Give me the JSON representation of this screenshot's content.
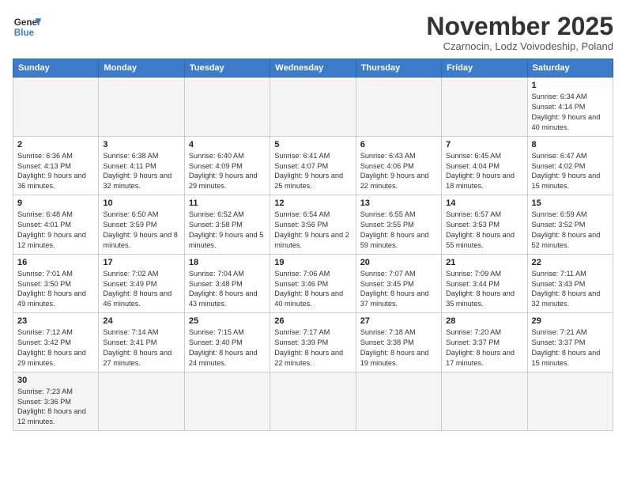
{
  "header": {
    "logo_general": "General",
    "logo_blue": "Blue",
    "month_title": "November 2025",
    "location": "Czarnocin, Lodz Voivodeship, Poland"
  },
  "weekdays": [
    "Sunday",
    "Monday",
    "Tuesday",
    "Wednesday",
    "Thursday",
    "Friday",
    "Saturday"
  ],
  "weeks": [
    [
      {
        "day": "",
        "info": "",
        "empty": true
      },
      {
        "day": "",
        "info": "",
        "empty": true
      },
      {
        "day": "",
        "info": "",
        "empty": true
      },
      {
        "day": "",
        "info": "",
        "empty": true
      },
      {
        "day": "",
        "info": "",
        "empty": true
      },
      {
        "day": "",
        "info": "",
        "empty": true
      },
      {
        "day": "1",
        "info": "Sunrise: 6:34 AM\nSunset: 4:14 PM\nDaylight: 9 hours and 40 minutes."
      }
    ],
    [
      {
        "day": "2",
        "info": "Sunrise: 6:36 AM\nSunset: 4:13 PM\nDaylight: 9 hours and 36 minutes."
      },
      {
        "day": "3",
        "info": "Sunrise: 6:38 AM\nSunset: 4:11 PM\nDaylight: 9 hours and 32 minutes."
      },
      {
        "day": "4",
        "info": "Sunrise: 6:40 AM\nSunset: 4:09 PM\nDaylight: 9 hours and 29 minutes."
      },
      {
        "day": "5",
        "info": "Sunrise: 6:41 AM\nSunset: 4:07 PM\nDaylight: 9 hours and 25 minutes."
      },
      {
        "day": "6",
        "info": "Sunrise: 6:43 AM\nSunset: 4:06 PM\nDaylight: 9 hours and 22 minutes."
      },
      {
        "day": "7",
        "info": "Sunrise: 6:45 AM\nSunset: 4:04 PM\nDaylight: 9 hours and 18 minutes."
      },
      {
        "day": "8",
        "info": "Sunrise: 6:47 AM\nSunset: 4:02 PM\nDaylight: 9 hours and 15 minutes."
      }
    ],
    [
      {
        "day": "9",
        "info": "Sunrise: 6:48 AM\nSunset: 4:01 PM\nDaylight: 9 hours and 12 minutes."
      },
      {
        "day": "10",
        "info": "Sunrise: 6:50 AM\nSunset: 3:59 PM\nDaylight: 9 hours and 8 minutes."
      },
      {
        "day": "11",
        "info": "Sunrise: 6:52 AM\nSunset: 3:58 PM\nDaylight: 9 hours and 5 minutes."
      },
      {
        "day": "12",
        "info": "Sunrise: 6:54 AM\nSunset: 3:56 PM\nDaylight: 9 hours and 2 minutes."
      },
      {
        "day": "13",
        "info": "Sunrise: 6:55 AM\nSunset: 3:55 PM\nDaylight: 8 hours and 59 minutes."
      },
      {
        "day": "14",
        "info": "Sunrise: 6:57 AM\nSunset: 3:53 PM\nDaylight: 8 hours and 55 minutes."
      },
      {
        "day": "15",
        "info": "Sunrise: 6:59 AM\nSunset: 3:52 PM\nDaylight: 8 hours and 52 minutes."
      }
    ],
    [
      {
        "day": "16",
        "info": "Sunrise: 7:01 AM\nSunset: 3:50 PM\nDaylight: 8 hours and 49 minutes."
      },
      {
        "day": "17",
        "info": "Sunrise: 7:02 AM\nSunset: 3:49 PM\nDaylight: 8 hours and 46 minutes."
      },
      {
        "day": "18",
        "info": "Sunrise: 7:04 AM\nSunset: 3:48 PM\nDaylight: 8 hours and 43 minutes."
      },
      {
        "day": "19",
        "info": "Sunrise: 7:06 AM\nSunset: 3:46 PM\nDaylight: 8 hours and 40 minutes."
      },
      {
        "day": "20",
        "info": "Sunrise: 7:07 AM\nSunset: 3:45 PM\nDaylight: 8 hours and 37 minutes."
      },
      {
        "day": "21",
        "info": "Sunrise: 7:09 AM\nSunset: 3:44 PM\nDaylight: 8 hours and 35 minutes."
      },
      {
        "day": "22",
        "info": "Sunrise: 7:11 AM\nSunset: 3:43 PM\nDaylight: 8 hours and 32 minutes."
      }
    ],
    [
      {
        "day": "23",
        "info": "Sunrise: 7:12 AM\nSunset: 3:42 PM\nDaylight: 8 hours and 29 minutes."
      },
      {
        "day": "24",
        "info": "Sunrise: 7:14 AM\nSunset: 3:41 PM\nDaylight: 8 hours and 27 minutes."
      },
      {
        "day": "25",
        "info": "Sunrise: 7:15 AM\nSunset: 3:40 PM\nDaylight: 8 hours and 24 minutes."
      },
      {
        "day": "26",
        "info": "Sunrise: 7:17 AM\nSunset: 3:39 PM\nDaylight: 8 hours and 22 minutes."
      },
      {
        "day": "27",
        "info": "Sunrise: 7:18 AM\nSunset: 3:38 PM\nDaylight: 8 hours and 19 minutes."
      },
      {
        "day": "28",
        "info": "Sunrise: 7:20 AM\nSunset: 3:37 PM\nDaylight: 8 hours and 17 minutes."
      },
      {
        "day": "29",
        "info": "Sunrise: 7:21 AM\nSunset: 3:37 PM\nDaylight: 8 hours and 15 minutes."
      }
    ],
    [
      {
        "day": "30",
        "info": "Sunrise: 7:23 AM\nSunset: 3:36 PM\nDaylight: 8 hours and 12 minutes.",
        "last": true
      },
      {
        "day": "",
        "info": "",
        "empty": true,
        "last": true
      },
      {
        "day": "",
        "info": "",
        "empty": true,
        "last": true
      },
      {
        "day": "",
        "info": "",
        "empty": true,
        "last": true
      },
      {
        "day": "",
        "info": "",
        "empty": true,
        "last": true
      },
      {
        "day": "",
        "info": "",
        "empty": true,
        "last": true
      },
      {
        "day": "",
        "info": "",
        "empty": true,
        "last": true
      }
    ]
  ]
}
